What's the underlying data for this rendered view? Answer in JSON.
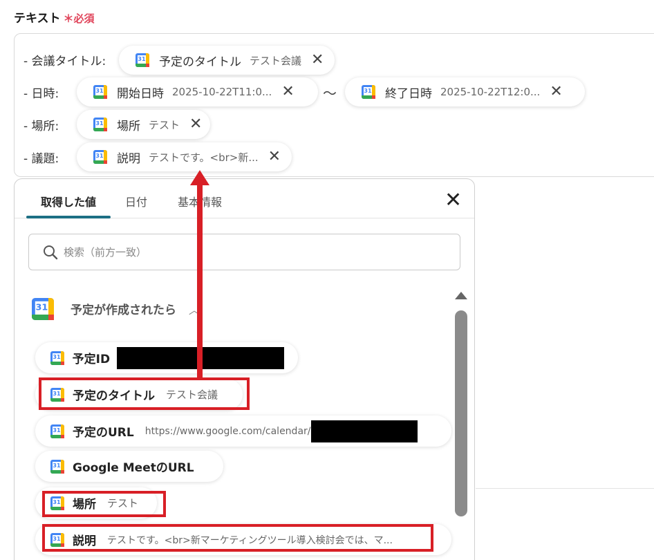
{
  "field": {
    "label": "テキスト",
    "required": "＊必須"
  },
  "rows": [
    {
      "label": "- 会議タイトル:",
      "chips": [
        {
          "name": "予定のタイトル",
          "value": "テスト会議"
        }
      ]
    },
    {
      "label": "- 日時:",
      "chips": [
        {
          "name": "開始日時",
          "value": "2025-10-22T11:0..."
        },
        {
          "name": "終了日時",
          "value": "2025-10-22T12:0..."
        }
      ],
      "separator": "〜"
    },
    {
      "label": "- 場所:",
      "chips": [
        {
          "name": "場所",
          "value": "テスト"
        }
      ]
    },
    {
      "label": "- 議題:",
      "chips": [
        {
          "name": "説明",
          "value": "テストです。<br>新..."
        }
      ]
    }
  ],
  "calendar_icon_text": "31",
  "panel": {
    "tabs": [
      {
        "label": "取得した値"
      },
      {
        "label": "日付"
      },
      {
        "label": "基本情報"
      }
    ],
    "search_placeholder": "検索（前方一致）",
    "group_title": "予定が作成されたら",
    "items": [
      {
        "name": "予定ID",
        "value": ""
      },
      {
        "name": "予定のタイトル",
        "value": "テスト会議"
      },
      {
        "name": "予定のURL",
        "value": "https://www.google.com/calendar/"
      },
      {
        "name": "Google MeetのURL",
        "value": ""
      },
      {
        "name": "場所",
        "value": "テスト"
      },
      {
        "name": "説明",
        "value": "テストです。<br>新マーケティングツール導入検討会では、マ..."
      }
    ]
  },
  "colors": {
    "highlight": "#d81f26",
    "tab_indicator": "#1d6f84",
    "required": "#e0445a"
  }
}
